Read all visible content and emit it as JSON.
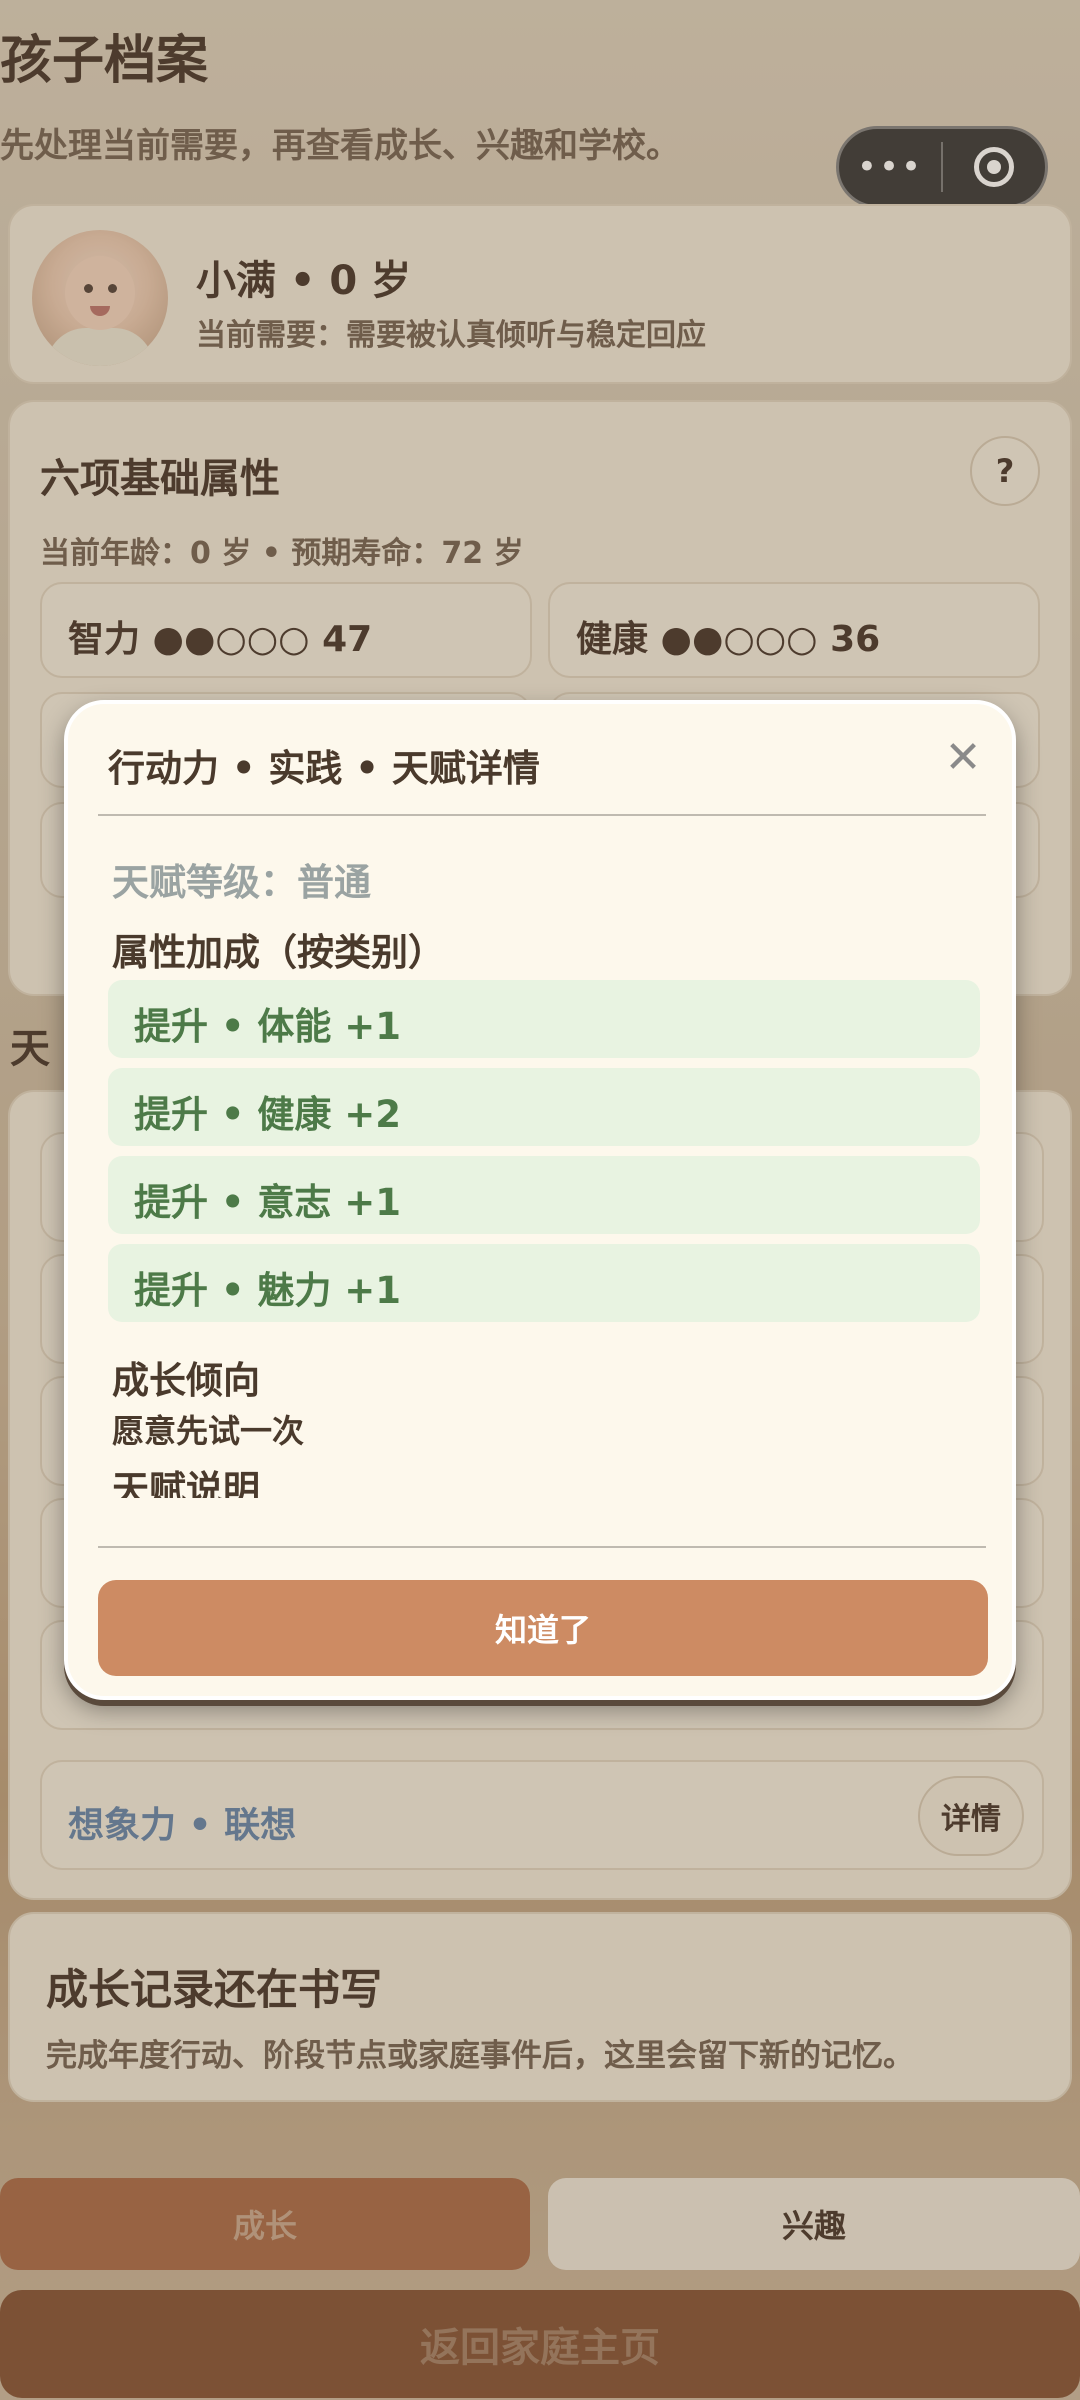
{
  "header": {
    "title": "孩子档案",
    "subtitle": "先处理当前需要，再查看成长、兴趣和学校。",
    "menu_dots": "•••"
  },
  "profile": {
    "name": "小满 • 0 岁",
    "need": "当前需要：需要被认真倾听与稳定回应"
  },
  "attributes": {
    "title": "六项基础属性",
    "help": "?",
    "age_line": "当前年龄：0 岁 • 预期寿命：72 岁",
    "items": [
      {
        "label": "智力 ●●○○○ 47"
      },
      {
        "label": "健康 ●●○○○ 36"
      }
    ]
  },
  "talents": {
    "section_title": "天",
    "rows": [
      {
        "label": "想象力 • 联想",
        "button": "详情"
      }
    ]
  },
  "record": {
    "title": "成长记录还在书写",
    "desc": "完成年度行动、阶段节点或家庭事件后，这里会留下新的记忆。"
  },
  "tabs": {
    "grow": "成长",
    "interest": "兴趣"
  },
  "back_button": "返回家庭主页",
  "modal": {
    "title": "行动力 • 实践 • 天赋详情",
    "close": "✕",
    "level": "天赋等级：普通",
    "bonus_heading": "属性加成（按类别）",
    "bonuses": [
      {
        "text": "提升 • 体能 +1"
      },
      {
        "text": "提升 • 健康 +2"
      },
      {
        "text": "提升 • 意志 +1"
      },
      {
        "text": "提升 • 魅力 +1"
      }
    ],
    "trend_heading": "成长倾向",
    "trend_text": "愿意先试一次",
    "desc_heading": "天赋说明",
    "ok_button": "知道了"
  }
}
